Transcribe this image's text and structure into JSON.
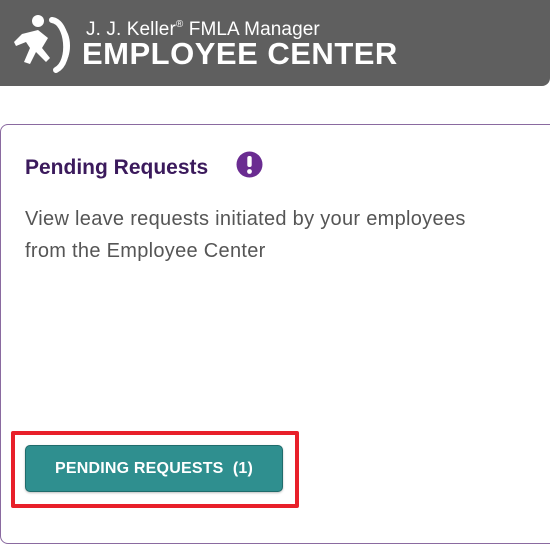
{
  "header": {
    "subtitle_prefix": "J. J. Keller",
    "subtitle_reg": "®",
    "subtitle_suffix": " FMLA Manager",
    "title": "EMPLOYEE CENTER",
    "logo_icon": "running-figure-logo-icon",
    "background_color": "#5f5f5f"
  },
  "card": {
    "title": "Pending Requests",
    "alert_icon": "exclamation-circle-icon",
    "alert_icon_color": "#6a2c91",
    "description": "View leave requests initiated by your employees from the Employee Center",
    "button_label": "PENDING REQUESTS",
    "button_count": "(1)",
    "button_color": "#2f8f8f",
    "highlight_color": "#e8202a"
  }
}
